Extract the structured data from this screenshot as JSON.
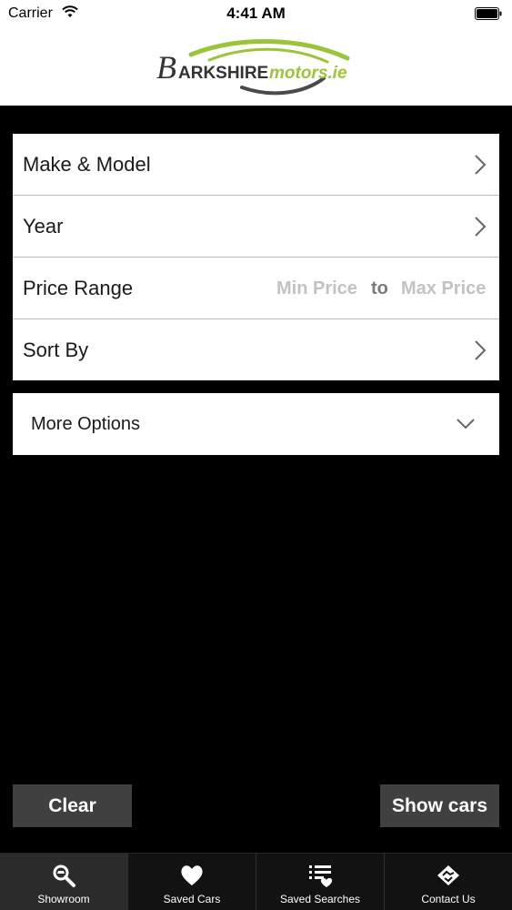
{
  "status_bar": {
    "carrier": "Carrier",
    "time": "4:41 AM"
  },
  "header": {
    "logo_text_1": "BARKSHIRE",
    "logo_text_2": "motors.ie",
    "logo_accent_color": "#9cc43a"
  },
  "search": {
    "rows": [
      {
        "label": "Make & Model",
        "icon": "chevron-right-icon"
      },
      {
        "label": "Year",
        "icon": "chevron-right-icon"
      },
      {
        "label": "Price Range",
        "min_placeholder": "Min Price",
        "separator": "to",
        "max_placeholder": "Max Price"
      },
      {
        "label": "Sort By",
        "icon": "chevron-right-icon"
      }
    ],
    "more_options": {
      "label": "More Options",
      "icon": "chevron-down-icon"
    }
  },
  "actions": {
    "clear_label": "Clear",
    "show_label": "Show cars"
  },
  "tabbar": {
    "tabs": [
      {
        "label": "Showroom",
        "icon": "search-car-icon",
        "active": true
      },
      {
        "label": "Saved Cars",
        "icon": "heart-icon",
        "active": false
      },
      {
        "label": "Saved Searches",
        "icon": "list-heart-icon",
        "active": false
      },
      {
        "label": "Contact Us",
        "icon": "handshake-icon",
        "active": false
      }
    ]
  }
}
